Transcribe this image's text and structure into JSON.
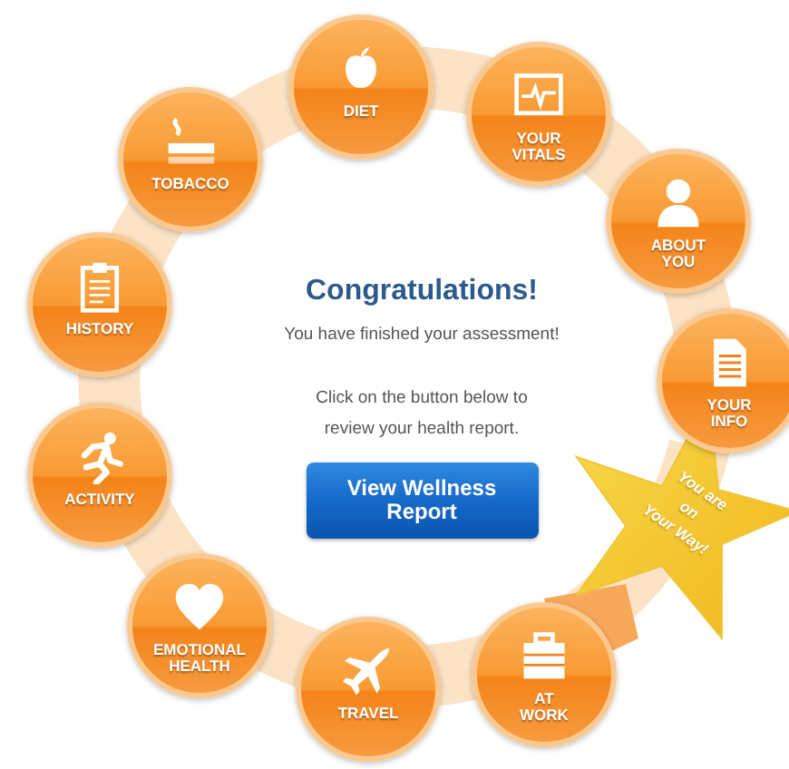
{
  "nodes": [
    {
      "label": "DIET"
    },
    {
      "label": "YOUR\nVITALS"
    },
    {
      "label": "ABOUT\nYOU"
    },
    {
      "label": "YOUR\nINFO"
    },
    {
      "label": "TOBACCO"
    },
    {
      "label": "HISTORY"
    },
    {
      "label": "ACTIVITY"
    },
    {
      "label": "EMOTIONAL\nHEALTH"
    },
    {
      "label": "TRAVEL"
    },
    {
      "label": "AT\nWORK"
    }
  ],
  "heading": "Congratulations!",
  "message": "You have finished your assessment!",
  "instruction": "Click on the button below to review your health report.",
  "button": "View Wellness\nReport",
  "star_text": "You are\non\nYour Way!"
}
